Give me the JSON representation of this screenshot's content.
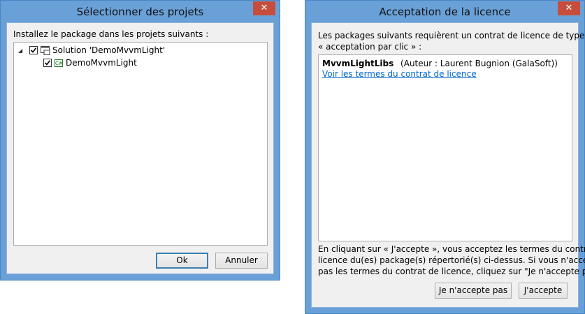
{
  "dialog1": {
    "title": "Sélectionner des projets",
    "close_label": "✕",
    "instruction": "Installez le package dans les projets suivants :",
    "tree": {
      "solution": {
        "label": "Solution 'DemoMvvmLight'",
        "checked": true,
        "expander": "◢"
      },
      "project": {
        "label": "DemoMvvmLight",
        "checked": true,
        "icon_text": "C#"
      }
    },
    "ok_label": "Ok",
    "cancel_label": "Annuler"
  },
  "dialog2": {
    "title": "Acceptation de la licence",
    "close_label": "✕",
    "intro_line1": "Les packages suivants requièrent un contrat de licence de type",
    "intro_line2": "« acceptation par clic » :",
    "package": {
      "name": "MvvmLightLibs",
      "author": "(Auteur : Laurent Bugnion (GalaSoft))",
      "terms_link": "Voir les termes du contrat de licence"
    },
    "footer_line1": "En cliquant sur « J'accepte », vous acceptez les termes du contrat de",
    "footer_line2": "licence du(es) package(s) répertorié(s) ci-dessus. Si vous n'acceptez",
    "footer_line3": "pas les termes du contrat de licence, cliquez sur \"Je n'accepte pas\".",
    "decline_label": "Je n'accepte pas",
    "accept_label": "J'accepte"
  },
  "colors": {
    "window_frame": "#6aa0d8",
    "close_button": "#c74c3c",
    "link": "#0066cc",
    "default_button_border": "#3c7fb1"
  }
}
